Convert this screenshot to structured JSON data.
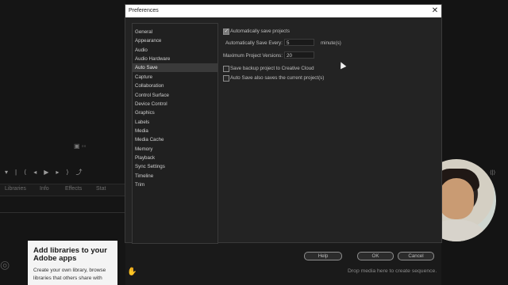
{
  "dialog": {
    "title": "Preferences",
    "close_glyph": "✕",
    "sidebar": [
      {
        "label": "General"
      },
      {
        "label": "Appearance"
      },
      {
        "label": "Audio"
      },
      {
        "label": "Audio Hardware"
      },
      {
        "label": "Auto Save",
        "selected": true
      },
      {
        "label": "Capture"
      },
      {
        "label": "Collaboration"
      },
      {
        "label": "Control Surface"
      },
      {
        "label": "Device Control"
      },
      {
        "label": "Graphics"
      },
      {
        "label": "Labels"
      },
      {
        "label": "Media"
      },
      {
        "label": "Media Cache"
      },
      {
        "label": "Memory"
      },
      {
        "label": "Playback"
      },
      {
        "label": "Sync Settings"
      },
      {
        "label": "Timeline"
      },
      {
        "label": "Trim"
      }
    ],
    "autosave": {
      "auto_save_label": "Automatically save projects",
      "auto_save_checked": true,
      "every_label": "Automatically Save Every:",
      "every_value": "5",
      "every_unit": "minute(s)",
      "max_versions_label": "Maximum Project Versions:",
      "max_versions_value": "20",
      "backup_cc_label": "Save backup project to Creative Cloud",
      "backup_cc_checked": false,
      "also_saves_label": "Auto Save also saves the current project(s)",
      "also_saves_checked": false
    },
    "buttons": {
      "help": "Help",
      "ok": "OK",
      "cancel": "Cancel"
    }
  },
  "background": {
    "panel_tabs": [
      "Libraries",
      "Info",
      "Effects",
      "Stat"
    ],
    "libraries_card": {
      "title": "Add libraries to your Adobe apps",
      "body": "Create your own library, browse libraries that others share with"
    },
    "drop_text": "Drop media here to create sequence."
  },
  "icons": {
    "close": "close-icon",
    "checkbox": "checkbox-icon",
    "cursor": "mouse-cursor-icon"
  },
  "colors": {
    "dialog_bg": "#232323",
    "titlebar": "#ffffff",
    "selected_item": "#3a3a3a",
    "card_bg": "#f4f4f4"
  }
}
